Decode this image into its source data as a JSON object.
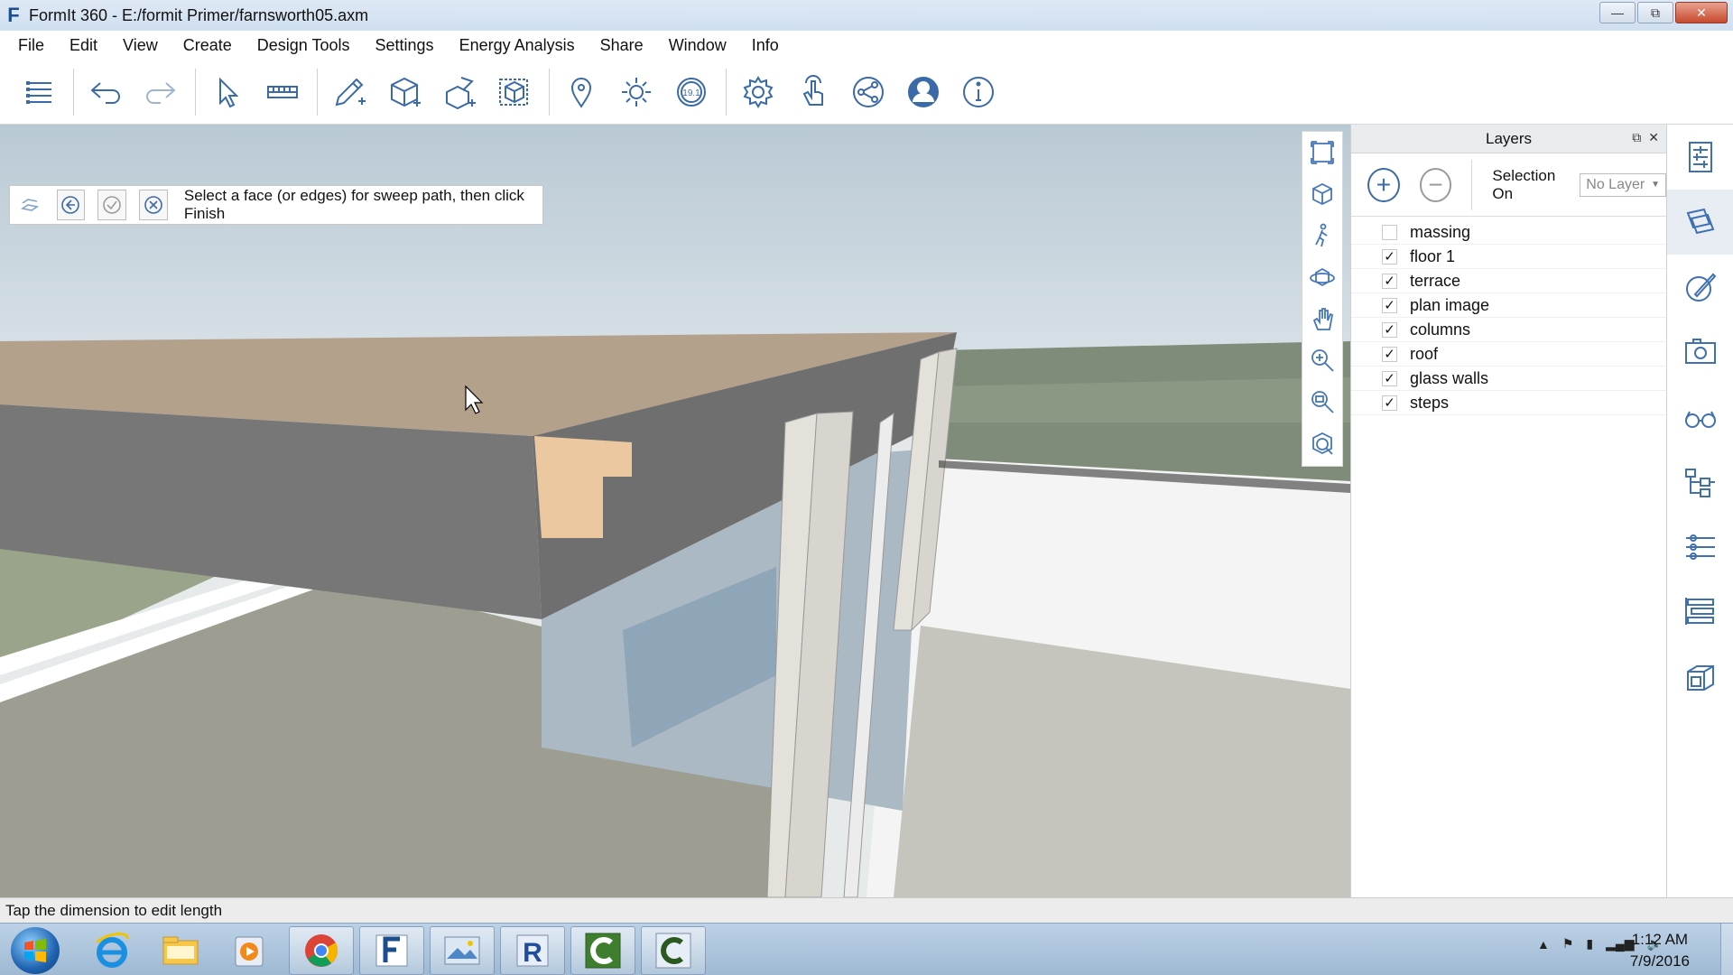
{
  "window": {
    "title": "FormIt 360 - E:/formit Primer/farnsworth05.axm",
    "app_logo": "F",
    "controls": [
      "minimize-icon",
      "restore-icon",
      "close-icon"
    ]
  },
  "menu": [
    "File",
    "Edit",
    "View",
    "Create",
    "Design Tools",
    "Settings",
    "Energy Analysis",
    "Share",
    "Window",
    "Info"
  ],
  "toolbar": {
    "tools": [
      "menu-icon",
      "undo-icon",
      "redo-icon",
      "select-icon",
      "tape-measure-icon",
      "sketch-icon",
      "cube-add-icon",
      "extrude-icon",
      "group-icon",
      "location-icon",
      "sun-icon",
      "version-badge-icon",
      "settings-icon",
      "gesture-icon",
      "share-icon",
      "user-icon",
      "info-icon"
    ],
    "version_badge": "19.1"
  },
  "command": {
    "prompt": "Select a face (or edges) for sweep path, then click Finish",
    "buttons": [
      "sweep-icon",
      "back-icon",
      "finish-icon",
      "cancel-icon"
    ]
  },
  "nav_strip": [
    "zoom-extents-icon",
    "perspective-icon",
    "walk-icon",
    "orbit-icon",
    "pan-icon",
    "zoom-icon",
    "zoom-window-icon",
    "view-cube-icon"
  ],
  "layers_panel": {
    "title": "Layers",
    "selection_label": "Selection On",
    "selection_value": "No Layer",
    "layers": [
      {
        "name": "massing",
        "checked": false
      },
      {
        "name": "floor 1",
        "checked": true
      },
      {
        "name": "terrace",
        "checked": true
      },
      {
        "name": "plan image",
        "checked": true
      },
      {
        "name": "columns",
        "checked": true
      },
      {
        "name": "roof",
        "checked": true
      },
      {
        "name": "glass walls",
        "checked": true
      },
      {
        "name": "steps",
        "checked": true
      }
    ]
  },
  "rail": [
    "properties-icon",
    "layers-icon",
    "materials-icon",
    "scenes-icon",
    "visual-styles-icon",
    "hierarchy-icon",
    "levels-icon",
    "groups-icon",
    "content-library-icon"
  ],
  "status": {
    "text": "Tap the dimension to edit length"
  },
  "taskbar": {
    "apps": [
      "ie-icon",
      "explorer-icon",
      "media-icon",
      "chrome-icon",
      "formit-icon",
      "photo-viewer-icon",
      "revit-icon",
      "camtasia-icon",
      "camtasia-recorder-icon"
    ],
    "clock_time": "1:12 AM",
    "clock_date": "7/9/2016"
  }
}
